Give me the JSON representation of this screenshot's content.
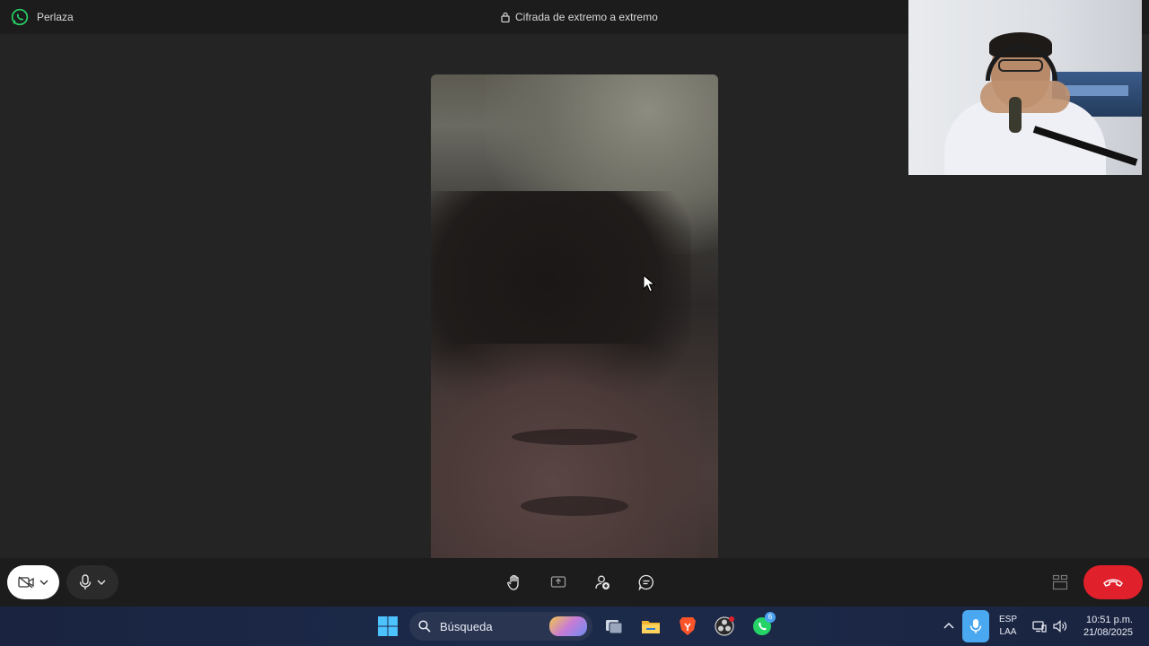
{
  "titlebar": {
    "contact_name": "Perlaza",
    "encryption_text": "Cifrada de extremo a extremo"
  },
  "icons": {
    "app": "whatsapp-icon",
    "lock": "lock-icon",
    "camera_off": "camera-off-icon",
    "mic": "microphone-icon",
    "raise_hand": "raise-hand-icon",
    "share_screen": "share-screen-icon",
    "add_participant": "add-participant-icon",
    "chat": "chat-icon",
    "layout": "layout-grid-icon",
    "end_call": "end-call-icon"
  },
  "colors": {
    "end_call": "#e0202b",
    "whatsapp": "#25d366",
    "taskbar": "#1c2a4a"
  },
  "taskbar": {
    "search_label": "Búsqueda",
    "whatsapp_badge": "6",
    "lang_line1": "ESP",
    "lang_line2": "LAA",
    "time": "10:51 p.m.",
    "date": "21/08/2025"
  }
}
